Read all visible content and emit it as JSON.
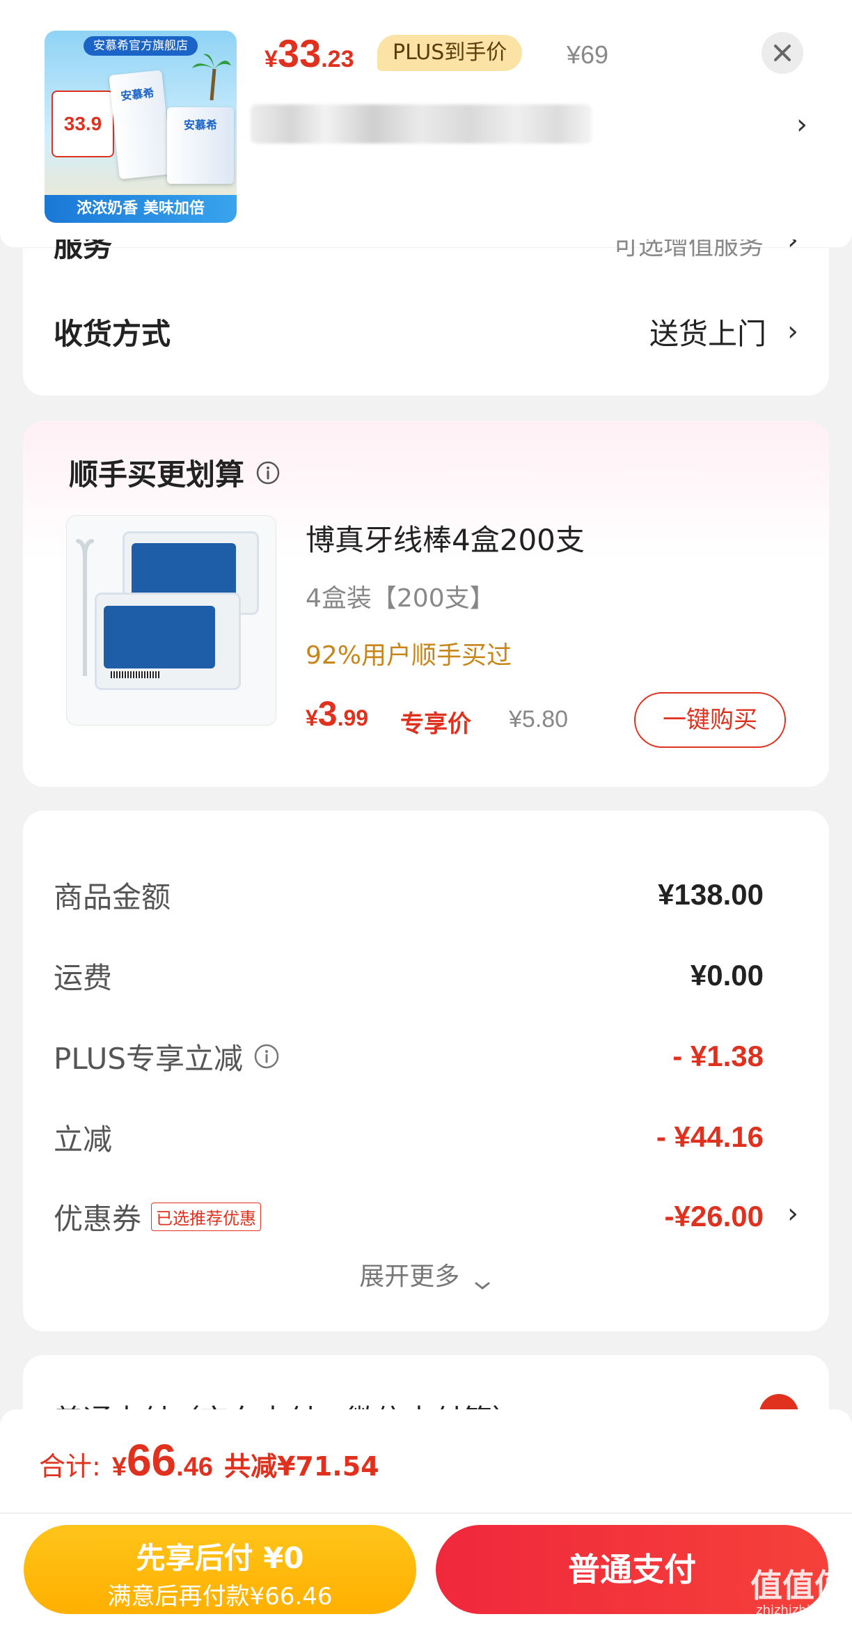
{
  "header": {
    "product_image": {
      "banner_top": "安慕希官方旗舰店",
      "price_tag": "33.9",
      "brand": "安慕希",
      "slogan": "浓浓奶香 美味加倍"
    },
    "price_currency": "¥",
    "price_int": "33",
    "price_dec": ".23",
    "plus_badge": "PLUS到手价",
    "orig_price": "¥69"
  },
  "service": {
    "label": "服务",
    "value": "可选增值服务"
  },
  "delivery": {
    "label": "收货方式",
    "value": "送货上门"
  },
  "upsell": {
    "title": "顺手买更划算",
    "product_name": "博真牙线棒4盒200支",
    "variant": "4盒装【200支】",
    "bought_note": "92%用户顺手买过",
    "price_currency": "¥",
    "price_int": "3",
    "price_dec": ".99",
    "price_tag": "专享价",
    "orig_price": "¥5.80",
    "buy_button": "一键购买"
  },
  "summary": {
    "rows": [
      {
        "label": "商品金额",
        "value": "¥138.00"
      },
      {
        "label": "运费",
        "value": "¥0.00"
      },
      {
        "label": "PLUS专享立减",
        "value": "- ¥1.38"
      },
      {
        "label": "立减",
        "value": "- ¥44.16"
      },
      {
        "label": "优惠券",
        "value": "-¥26.00"
      }
    ],
    "coupon_badge": "已选推荐优惠",
    "expand": "展开更多"
  },
  "payment_section_label": "普通支付（京东支付、微信支付等）",
  "footer": {
    "total_label": "合计:",
    "total_currency": "¥",
    "total_int": "66",
    "total_dec": ".46",
    "saved": "共减¥71.54",
    "bnpl_title": "先享后付 ¥0",
    "bnpl_sub": "满意后再付款¥66.46",
    "pay_button": "普通支付"
  },
  "watermark": {
    "main": "值值值",
    "sub": "zhizhizhi.com"
  },
  "colors": {
    "accent_red": "#e0301e",
    "gold_text": "#c7861a",
    "bnpl_yellow": "#ffb800",
    "pay_red": "#f2303a"
  }
}
